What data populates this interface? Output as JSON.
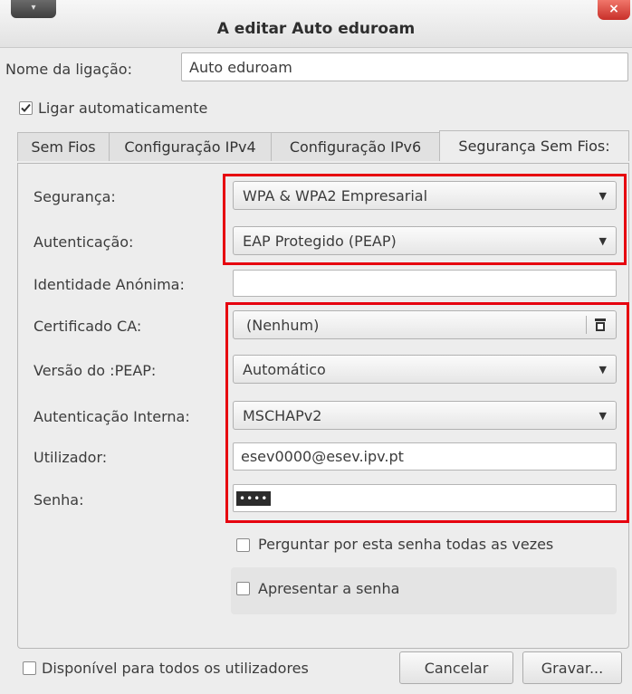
{
  "window": {
    "title": "A editar Auto eduroam",
    "menu_glyph": "▾",
    "close_glyph": "×"
  },
  "connection": {
    "name_label": "Nome da ligação:",
    "name_value": "Auto eduroam",
    "auto_connect_label": "Ligar automaticamente",
    "auto_connect_checked": true
  },
  "tabs": [
    {
      "label": "Sem Fios",
      "active": false
    },
    {
      "label": "Configuração IPv4",
      "active": false
    },
    {
      "label": "Configuração IPv6",
      "active": false
    },
    {
      "label": "Segurança Sem Fios:",
      "active": true
    }
  ],
  "security": {
    "security_label": "Segurança:",
    "security_value": "WPA & WPA2 Empresarial",
    "auth_label": "Autenticação:",
    "auth_value": "EAP Protegido (PEAP)",
    "anon_identity_label": "Identidade Anónima:",
    "anon_identity_value": "",
    "ca_cert_label": "Certificado CA:",
    "ca_cert_value": "(Nenhum)",
    "peap_version_label": "Versão do :PEAP:",
    "peap_version_value": "Automático",
    "inner_auth_label": "Autenticação Interna:",
    "inner_auth_value": "MSCHAPv2",
    "user_label": "Utilizador:",
    "user_value": "esev0000@esev.ipv.pt",
    "password_label": "Senha:",
    "password_mask": "••••",
    "ask_password_label": "Perguntar por esta senha todas as vezes",
    "ask_password_checked": false,
    "show_password_label": "Apresentar a senha",
    "show_password_checked": false
  },
  "footer": {
    "all_users_label": "Disponível para todos os utilizadores",
    "all_users_checked": false,
    "cancel_label": "Cancelar",
    "save_label": "Gravar..."
  },
  "colors": {
    "highlight": "#e6000f",
    "window_bg": "#ededed",
    "close_button": "#d9413a"
  },
  "icons": {
    "dropdown": "chevron-down-icon",
    "file_chooser": "file-chooser-icon",
    "check": "check-icon"
  }
}
